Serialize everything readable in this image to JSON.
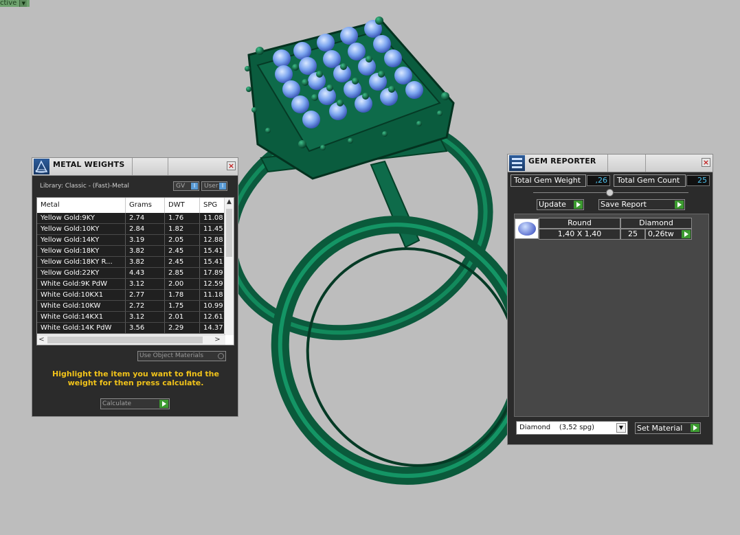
{
  "corner_tab": {
    "label": "ctive"
  },
  "metal_weights": {
    "title": "METAL WEIGHTS",
    "library": "Library: Classic - (Fast)-Metal",
    "toggle_gv": "GV",
    "toggle_user": "User",
    "columns": [
      "Metal",
      "Grams",
      "DWT",
      "SPG"
    ],
    "rows": [
      {
        "metal": "Yellow Gold:9KY",
        "grams": "2.74",
        "dwt": "1.76",
        "spg": "11.08"
      },
      {
        "metal": "Yellow Gold:10KY",
        "grams": "2.84",
        "dwt": "1.82",
        "spg": "11.45"
      },
      {
        "metal": "Yellow Gold:14KY",
        "grams": "3.19",
        "dwt": "2.05",
        "spg": "12.88"
      },
      {
        "metal": "Yellow Gold:18KY",
        "grams": "3.82",
        "dwt": "2.45",
        "spg": "15.41"
      },
      {
        "metal": "Yellow Gold:18KY R...",
        "grams": "3.82",
        "dwt": "2.45",
        "spg": "15.41"
      },
      {
        "metal": "Yellow Gold:22KY",
        "grams": "4.43",
        "dwt": "2.85",
        "spg": "17.89"
      },
      {
        "metal": "White Gold:9K PdW",
        "grams": "3.12",
        "dwt": "2.00",
        "spg": "12.59"
      },
      {
        "metal": "White Gold:10KX1",
        "grams": "2.77",
        "dwt": "1.78",
        "spg": "11.18"
      },
      {
        "metal": "White Gold:10KW",
        "grams": "2.72",
        "dwt": "1.75",
        "spg": "10.99"
      },
      {
        "metal": "White Gold:14KX1",
        "grams": "3.12",
        "dwt": "2.01",
        "spg": "12.61"
      },
      {
        "metal": "White Gold:14K PdW",
        "grams": "3.56",
        "dwt": "2.29",
        "spg": "14.37"
      }
    ],
    "use_object_materials": "Use Object Materials",
    "hint": "Highlight the item you want to find the weight for then press calculate.",
    "calculate": "Calculate"
  },
  "gem_reporter": {
    "title": "GEM REPORTER",
    "total_weight_label": "Total Gem Weight",
    "total_weight_value": ",26",
    "total_count_label": "Total Gem Count",
    "total_count_value": "25",
    "update": "Update",
    "save_report": "Save Report",
    "gem": {
      "shape": "Round",
      "material": "Diamond",
      "size": "1,40 X 1,40",
      "count": "25",
      "weight": "0,26tw"
    },
    "material_select": "Diamond    (3,52 spg)",
    "set_material": "Set Material"
  },
  "colors": {
    "ring": "#0e6b4a",
    "gem": "#7da6f0",
    "accent_play": "#3c9a30",
    "hint_text": "#f0c21a",
    "value_text": "#4fc3ef"
  }
}
